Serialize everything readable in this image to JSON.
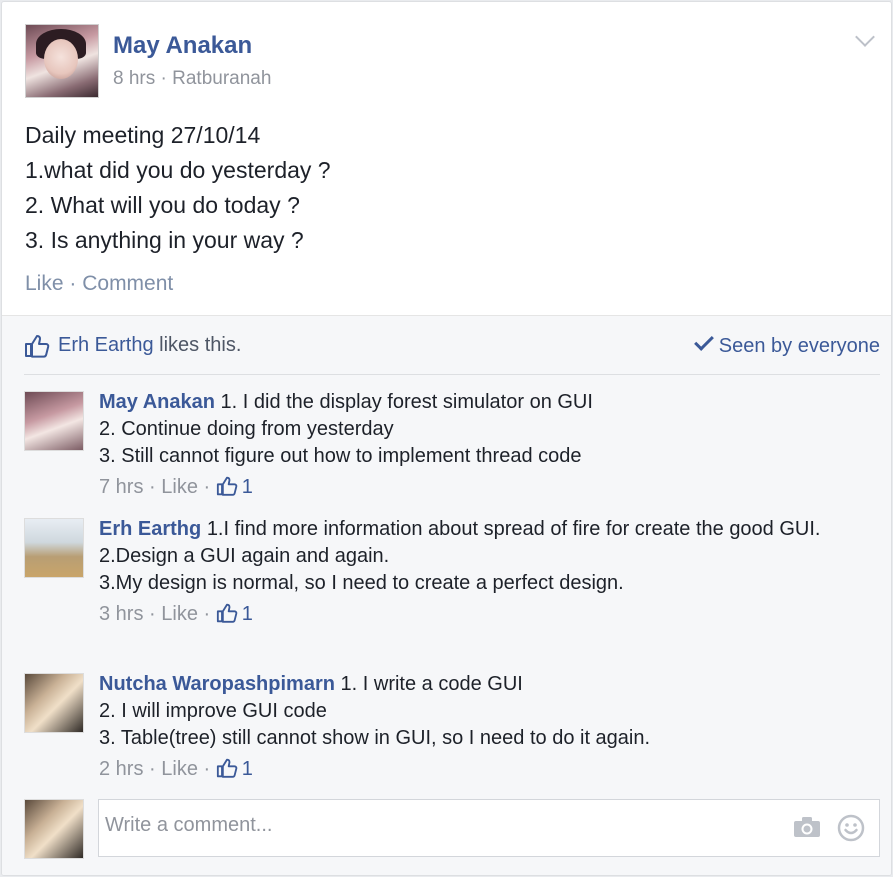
{
  "post": {
    "author": "May Anakan",
    "time": "8 hrs",
    "location": "Ratburanah",
    "body_lines": [
      "Daily meeting 27/10/14",
      "1.what did you do yesterday ?",
      "2. What will you do today ?",
      "3. Is anything in your way ?"
    ],
    "actions": {
      "like": "Like",
      "separator": "·",
      "comment": "Comment"
    }
  },
  "likes": {
    "name": "Erh Earthg",
    "suffix": " likes this.",
    "seen": "Seen by everyone"
  },
  "comments": [
    {
      "author": "May Anakan",
      "lines": [
        "1. I did the display forest simulator on GUI",
        "2. Continue doing from yesterday",
        "3. Still cannot figure out how to implement thread code"
      ],
      "time": "7 hrs",
      "like": "Like",
      "like_count": "1"
    },
    {
      "author": "Erh Earthg",
      "lines": [
        "1.I find more information about spread of fire for create the good GUI.",
        "2.Design a GUI again and again.",
        "3.My design is normal, so I need to create a perfect design."
      ],
      "time": "3 hrs",
      "like": "Like",
      "like_count": "1"
    },
    {
      "author": "Nutcha Waropashpimarn",
      "lines": [
        "1. I write a code GUI",
        "2. I will improve GUI code",
        "3. Table(tree) still cannot show in GUI, so I need to do it again."
      ],
      "time": "2 hrs",
      "like": "Like",
      "like_count": "1"
    }
  ],
  "write_comment": {
    "placeholder": "Write a comment..."
  },
  "colors": {
    "link": "#3b5998",
    "meta": "#90949c",
    "background": "#f6f7f9"
  },
  "icons": [
    "chevron-down-icon",
    "thumbs-up-icon",
    "checkmark-icon",
    "camera-icon",
    "smiley-icon"
  ]
}
